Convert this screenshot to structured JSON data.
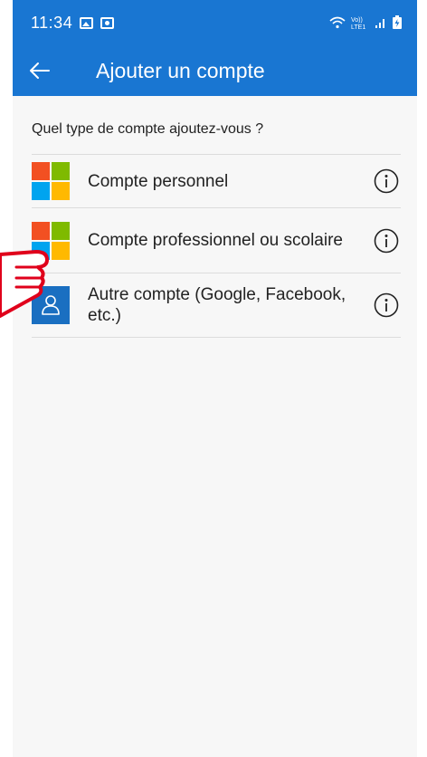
{
  "status_bar": {
    "time": "11:34",
    "network_text": "Vo))\nLTE1"
  },
  "toolbar": {
    "title": "Ajouter un compte"
  },
  "question": "Quel type de compte ajoutez-vous ?",
  "accounts": [
    {
      "label": "Compte personnel",
      "logo": "microsoft-logo"
    },
    {
      "label": "Compte professionnel ou scolaire",
      "logo": "microsoft-logo"
    },
    {
      "label": "Autre compte (Google, Facebook, etc.)",
      "logo": "person-icon"
    }
  ],
  "colors": {
    "primary": "#1976d2",
    "ms_red": "#f25022",
    "ms_green": "#7fba00",
    "ms_blue": "#00a4ef",
    "ms_yellow": "#ffb900",
    "person_blue": "#1a6fc1",
    "pointer_red": "#e0001b"
  }
}
